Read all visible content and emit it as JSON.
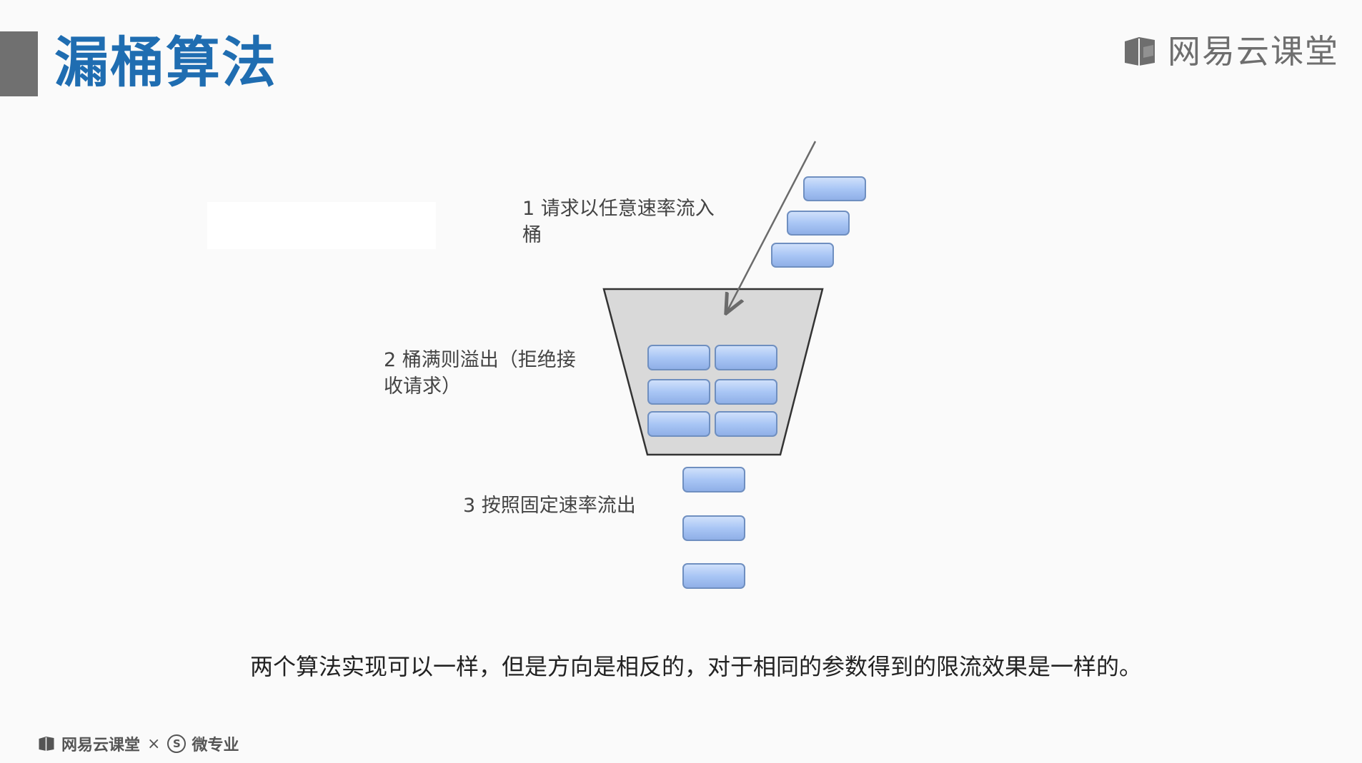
{
  "header": {
    "title": "漏桶算法",
    "brand_name": "网易云课堂",
    "brand_icon": "book-icon"
  },
  "diagram": {
    "step1_label": "1 请求以任意速率流入\n桶",
    "step2_label": "2 桶满则溢出（拒绝接\n收请求）",
    "step3_label": "3 按照固定速率流出",
    "incoming_request_count": 3,
    "bucket_request_count": 6,
    "outgoing_request_count": 3,
    "colors": {
      "bucket_fill": "#d9d9d9",
      "request_fill": "#a9c6f5",
      "request_border": "#6f8fc0"
    }
  },
  "caption": "两个算法实现可以一样，但是方向是相反的，对于相同的参数得到的限流效果是一样的。",
  "footer": {
    "brand": "网易云课堂",
    "separator": "×",
    "partner_seal": "S",
    "partner": "微专业"
  }
}
